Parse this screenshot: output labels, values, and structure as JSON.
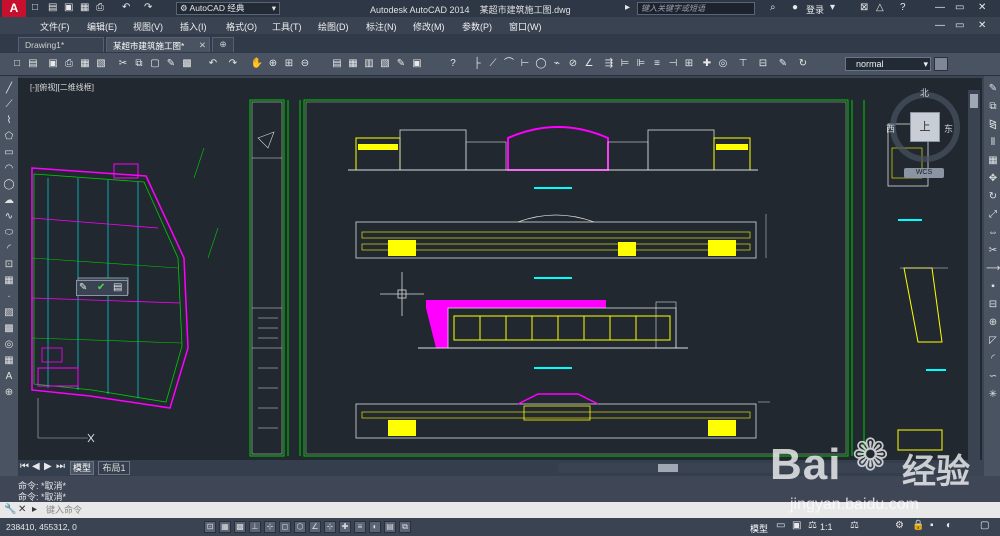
{
  "title": {
    "workspace": "AutoCAD 经典",
    "app_title": "Autodesk AutoCAD 2014",
    "file_name": "某超市建筑施工图.dwg",
    "search_placeholder": "键入关键字或短语",
    "login_label": "登录",
    "help_label": "?"
  },
  "menu": [
    "文件(F)",
    "编辑(E)",
    "视图(V)",
    "插入(I)",
    "格式(O)",
    "工具(T)",
    "绘图(D)",
    "标注(N)",
    "修改(M)",
    "参数(P)",
    "窗口(W)"
  ],
  "file_tabs": [
    {
      "label": "Drawing1*",
      "active": false
    },
    {
      "label": "某超市建筑施工图*",
      "active": true
    }
  ],
  "toolbar": {
    "style_value": "normal"
  },
  "viewport": {
    "label": "[-][俯视][二维线框]"
  },
  "viewcube": {
    "north": "北",
    "west": "西",
    "east": "东",
    "top": "上",
    "wcs": "WCS"
  },
  "layout_tabs": [
    "模型",
    "布局1"
  ],
  "command": {
    "history": [
      "命令: *取消*",
      "命令: *取消*"
    ],
    "input_placeholder": "键入命令"
  },
  "status": {
    "coordinates": "238410, 455312, 0",
    "mode": "模型",
    "scale": "1:1"
  },
  "watermark": {
    "brand": "Bai",
    "brand_cn": "经验",
    "url": "jingyan.baidu.com"
  },
  "colors": {
    "accent_red": "#c8102e",
    "drawing_yellow": "#ffff00",
    "drawing_magenta": "#ff00ff",
    "drawing_green": "#00cc00",
    "drawing_cyan": "#00ffff",
    "canvas_bg": "#212830"
  }
}
